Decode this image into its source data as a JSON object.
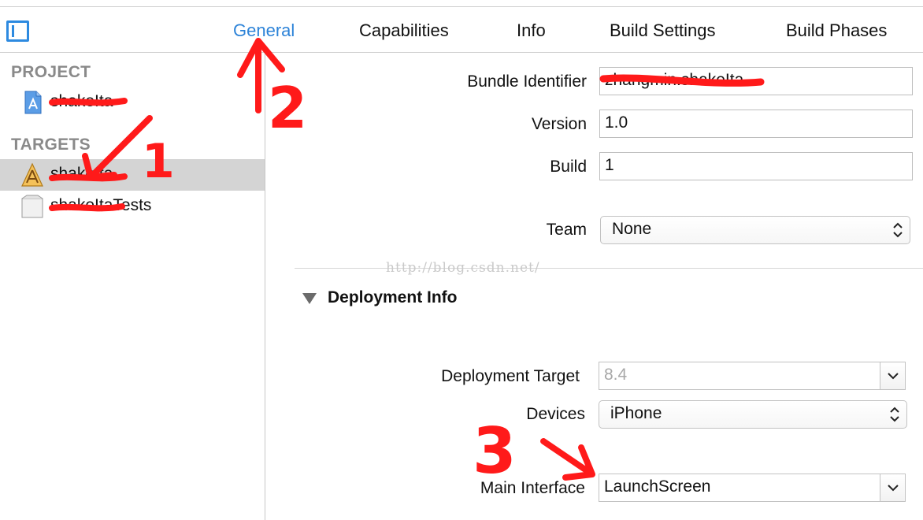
{
  "tabs": [
    {
      "label": "General",
      "active": true
    },
    {
      "label": "Capabilities",
      "active": false
    },
    {
      "label": "Info",
      "active": false
    },
    {
      "label": "Build Settings",
      "active": false
    },
    {
      "label": "Build Phases",
      "active": false
    }
  ],
  "sidebar": {
    "project_header": "PROJECT",
    "project_item": "shakeIta",
    "targets_header": "TARGETS",
    "target_items": [
      {
        "label": "shakeIta",
        "selected": true,
        "icon": "app-target-icon"
      },
      {
        "label": "shakeItaTests",
        "selected": false,
        "icon": "test-bundle-icon"
      }
    ]
  },
  "identity": {
    "bundle_identifier_label": "Bundle Identifier",
    "bundle_identifier_value": "zhangmin.shakeIta",
    "version_label": "Version",
    "version_value": "1.0",
    "build_label": "Build",
    "build_value": "1",
    "team_label": "Team",
    "team_value": "None"
  },
  "watermark": "http://blog.csdn.net/",
  "deployment": {
    "section_title": "Deployment Info",
    "target_label": "Deployment Target",
    "target_value": "8.4",
    "devices_label": "Devices",
    "devices_value": "iPhone",
    "main_interface_label": "Main Interface",
    "main_interface_value": "LaunchScreen"
  },
  "annotations": [
    "1",
    "2",
    "3"
  ],
  "colors": {
    "accent": "#2d83d8",
    "annotation_red": "#ff1a1a",
    "selection": "#d4d4d4"
  }
}
